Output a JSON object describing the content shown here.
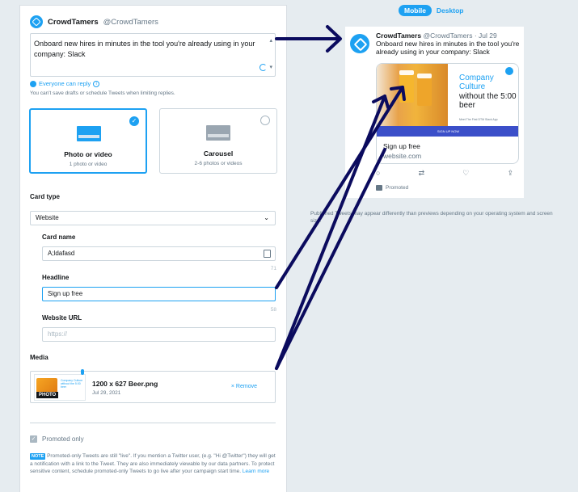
{
  "composer": {
    "account_name": "CrowdTamers",
    "account_handle": "@CrowdTamers",
    "tweet_text": "Onboard new hires in minutes in the tool you're already using in your company: Slack",
    "reply_setting": "Everyone can reply",
    "draft_note": "You can't save drafts or schedule Tweets when limiting replies."
  },
  "formats": [
    {
      "title": "Photo or video",
      "sub": "1 photo or video"
    },
    {
      "title": "Carousel",
      "sub": "2-6 photos or videos"
    }
  ],
  "card": {
    "type_label": "Card type",
    "type_value": "Website",
    "name_label": "Card name",
    "name_value": "A;ldafasd",
    "name_count": "71",
    "headline_label": "Headline",
    "headline_value": "Sign up free",
    "headline_count": "58",
    "url_label": "Website URL",
    "url_placeholder": "https://"
  },
  "media": {
    "label": "Media",
    "file_name": "1200 x 627 Beer.png",
    "file_date": "Jul 29, 2021",
    "remove_label": "× Remove",
    "thumb_tag": "PHOTO",
    "thumb_text": "Company Culture without the 5:00 beer"
  },
  "promoted": {
    "label": "Promoted only",
    "note_tag": "NOTE",
    "note_text": "Promoted-only Tweets are still \"live\". If you mention a Twitter user, (e.g. \"Hi @Twitter\") they will get a notification with a link to the Tweet. They are also immediately viewable by our data partners. To protect sensitive content, schedule promoted-only Tweets to go live after your campaign start time.",
    "learn_more": "Learn more"
  },
  "preview": {
    "tab_mobile": "Mobile",
    "tab_desktop": "Desktop",
    "name": "CrowdTamers",
    "handle_date": "@CrowdTamers · Jul 29",
    "text": "Onboard new hires in minutes in the tool you're already using in your company: Slack",
    "card_title_blue": "Company Culture",
    "card_title_dark": "without the 5:00 beer",
    "card_caption": "Meet The First DTM Slack App",
    "card_bar": "SIGN UP NOW",
    "headline": "Sign up free",
    "url": "website.com",
    "promoted": "Promoted",
    "disclaimer": "Published Tweets may appear differently than previews depending on your operating system and screen size."
  },
  "colors": {
    "accent": "#1da1f2",
    "annotation": "#0b0b5e",
    "background": "#e6ecf0"
  }
}
